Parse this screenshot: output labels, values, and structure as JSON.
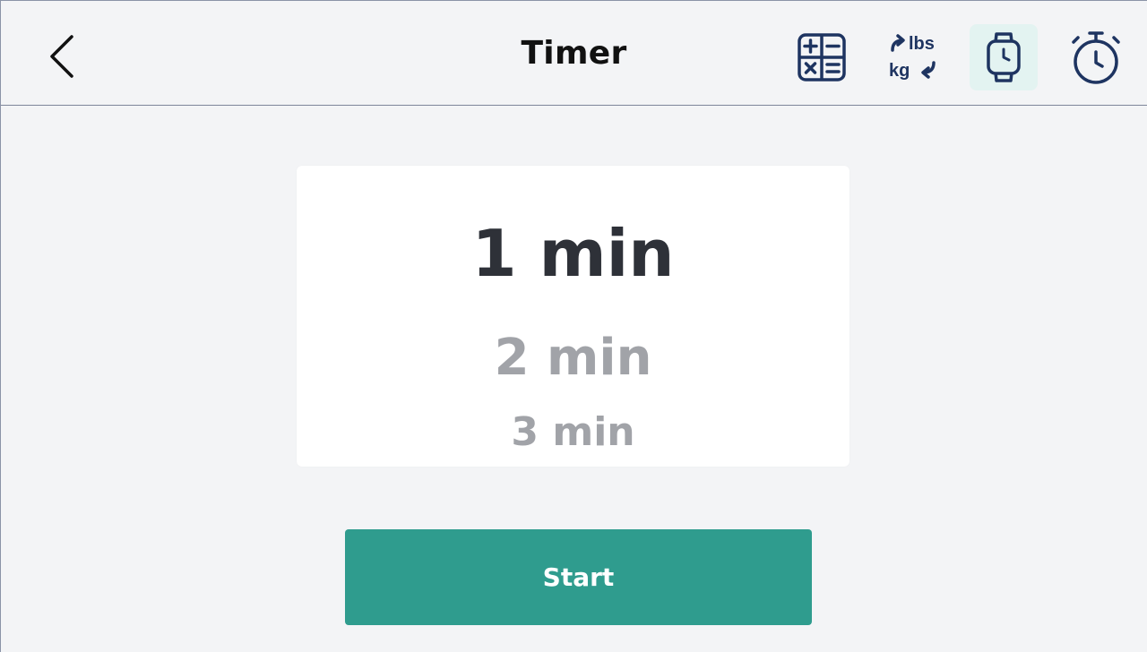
{
  "header": {
    "title": "Timer",
    "back_icon": "chevron-left-icon",
    "tools": [
      {
        "name": "calculator",
        "icon": "calculator-icon",
        "active": false
      },
      {
        "name": "unit-converter",
        "icon": "lbs-kg-converter-icon",
        "label_top": "lbs",
        "label_bottom": "kg",
        "active": false
      },
      {
        "name": "watch",
        "icon": "watch-icon",
        "active": true
      },
      {
        "name": "stopwatch",
        "icon": "stopwatch-icon",
        "active": false
      }
    ]
  },
  "picker": {
    "options": [
      "1 min",
      "2 min",
      "3 min"
    ],
    "selected": "1 min"
  },
  "start_label": "Start",
  "colors": {
    "background": "#f3f4f6",
    "accent": "#2f9c8e",
    "icon": "#1e3461",
    "active_tool_bg": "#e3f3f1",
    "selected_text": "#2e3138",
    "muted_text": "#a1a3a8"
  }
}
